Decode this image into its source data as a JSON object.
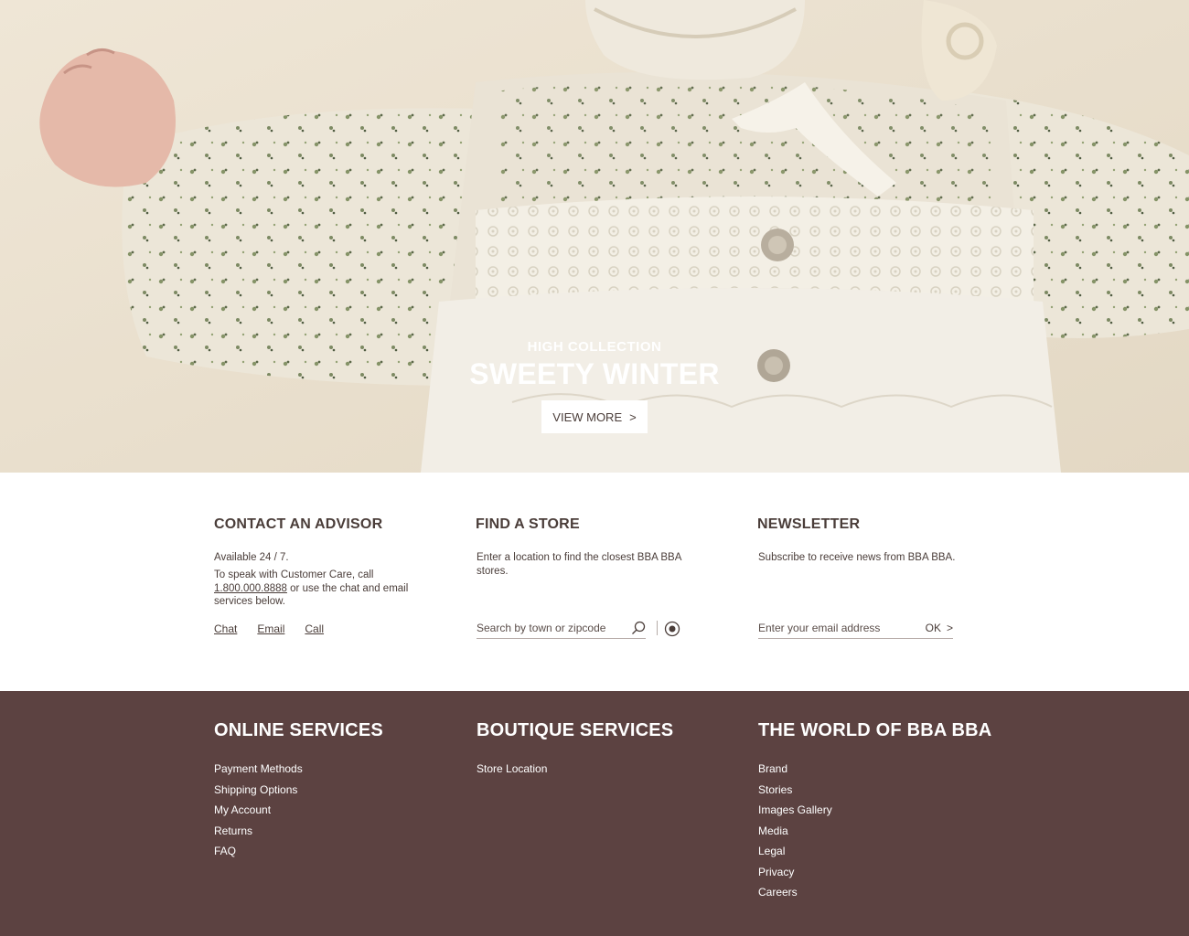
{
  "hero": {
    "kicker": "HIGH COLLECTION",
    "title": "SWEETY WINTER",
    "button_label": "VIEW MORE",
    "button_icon": "chevron-right-icon",
    "button_arrow": ">"
  },
  "contact": {
    "title": "CONTACT AN ADVISOR",
    "availability": "Available 24 / 7.",
    "text_before": "To speak with Customer Care, call",
    "phone": "1.800.000.8888",
    "text_after": " or use the chat and email services below.",
    "links": [
      "Chat",
      "Email",
      "Call"
    ]
  },
  "store": {
    "title": "FIND A STORE",
    "description": "Enter a location to find the closest BBA BBA stores.",
    "search_placeholder": "Search by town or zipcode",
    "search_icon": "search-icon",
    "locate_icon": "locate-icon"
  },
  "newsletter": {
    "title": "NEWSLETTER",
    "description": "Subscribe to receive news from BBA BBA.",
    "email_placeholder": "Enter your email address",
    "submit_label": "OK",
    "submit_arrow": ">"
  },
  "footer": {
    "online": {
      "title": "ONLINE SERVICES",
      "items": [
        "Payment Methods",
        "Shipping Options",
        "My Account",
        "Returns",
        "FAQ"
      ]
    },
    "boutique": {
      "title": "BOUTIQUE SERVICES",
      "items": [
        "Store Location"
      ]
    },
    "world": {
      "title": "THE WORLD OF BBA BBA",
      "items": [
        "Brand",
        "Stories",
        "Images Gallery",
        "Media",
        "Legal",
        "Privacy",
        "Careers"
      ]
    }
  },
  "colors": {
    "footer_bg": "#5c4241",
    "text": "#4a3d39",
    "hero_bg": "#ece3d3"
  }
}
